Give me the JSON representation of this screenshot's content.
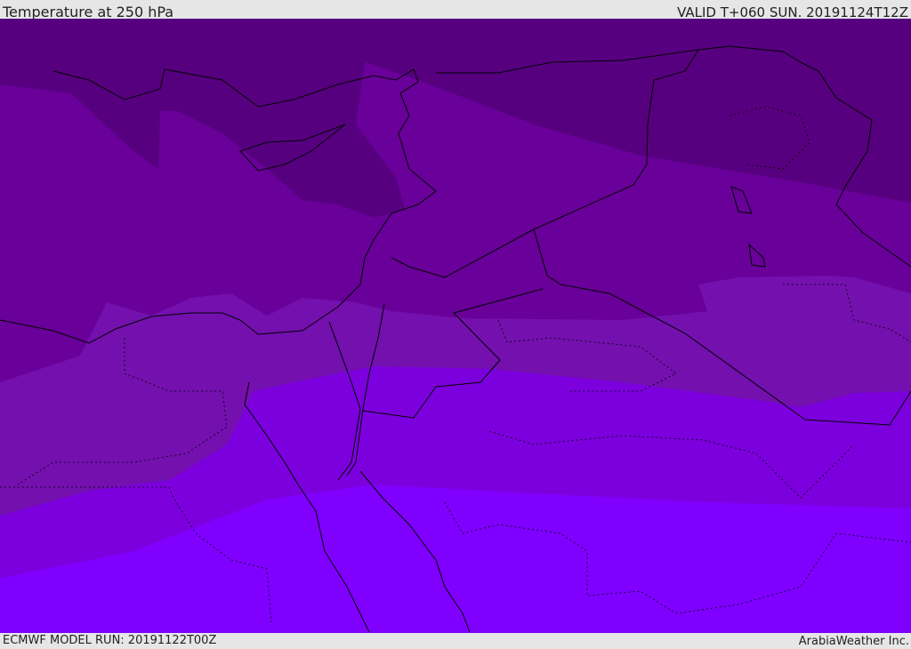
{
  "header": {
    "title": "Temperature at 250 hPa",
    "valid": "VALID T+060 SUN. 20191124T12Z"
  },
  "footer": {
    "model_run": "ECMWF MODEL RUN: 20191122T00Z",
    "credit": "ArabiaWeather Inc."
  },
  "colors": {
    "band_coldest": "#57007f",
    "band_2": "#680099",
    "band_3": "#7310ae",
    "band_4": "#7c00dd",
    "band_warmest": "#7f00ff",
    "coastline": "#000000"
  }
}
